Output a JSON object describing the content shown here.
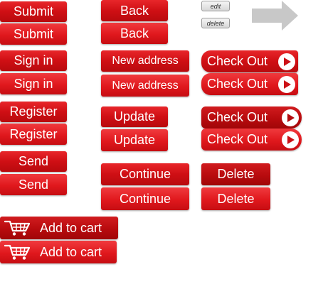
{
  "buttons": {
    "submit": "Submit",
    "sign_in": "Sign in",
    "register": "Register",
    "send": "Send",
    "back": "Back",
    "new_address": "New address",
    "update": "Update",
    "continue": "Continue",
    "check_out": "Check Out",
    "delete": "Delete",
    "add_to_cart": "Add to cart",
    "edit_small": "edit",
    "delete_small": "delete"
  },
  "colors": {
    "button_red": "#cf0f14",
    "button_text": "#ffffff",
    "arrow_gray": "#c8c8c8"
  },
  "icons": {
    "next": "arrow-right-icon",
    "checkout": "play-circle-icon",
    "cart": "shopping-cart-icon"
  }
}
